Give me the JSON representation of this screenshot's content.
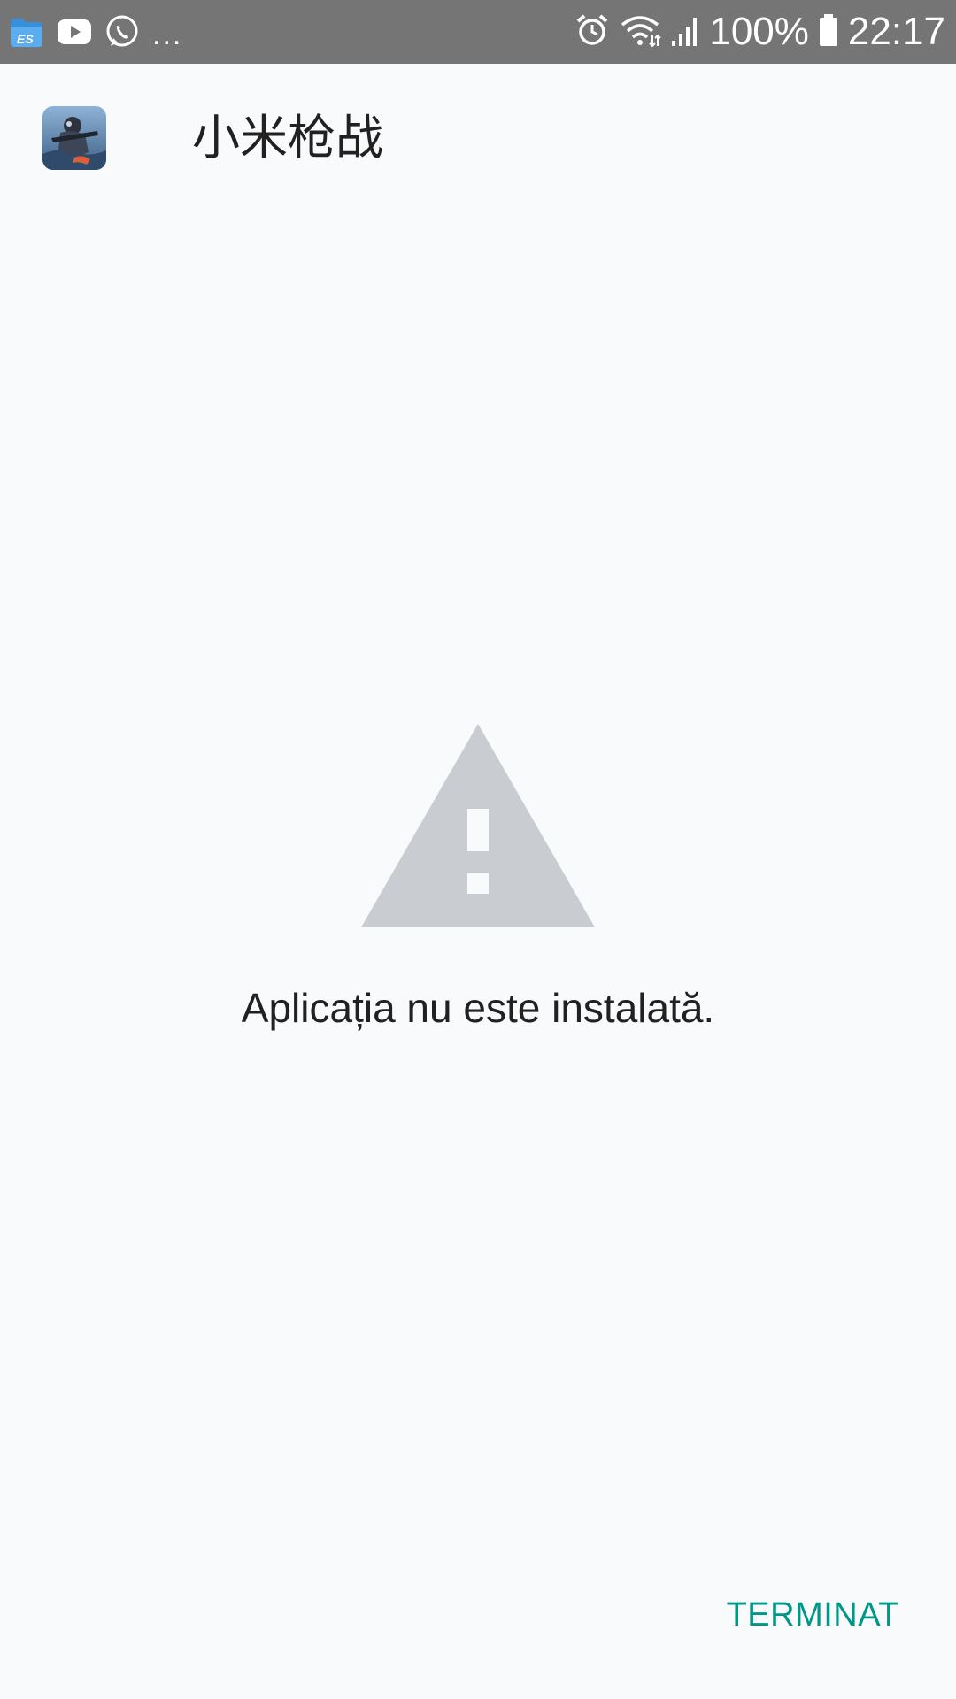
{
  "status_bar": {
    "notification_icons": [
      "es-file-explorer-icon",
      "youtube-icon",
      "whatsapp-icon"
    ],
    "more_indicator": "...",
    "system_icons": [
      "alarm-icon",
      "wifi-icon",
      "signal-icon",
      "battery-icon"
    ],
    "battery_percent": "100%",
    "time": "22:17"
  },
  "header": {
    "app_icon": "app-icon",
    "app_name": "小米枪战"
  },
  "body": {
    "icon": "warning-icon",
    "icon_color": "#c9cdd1",
    "message": "Aplicația nu este instalată."
  },
  "actions": {
    "done_label": "TERMINAT",
    "accent_color": "#009688"
  },
  "colors": {
    "status_bar_bg": "#757575",
    "page_bg": "#f9fafb"
  }
}
